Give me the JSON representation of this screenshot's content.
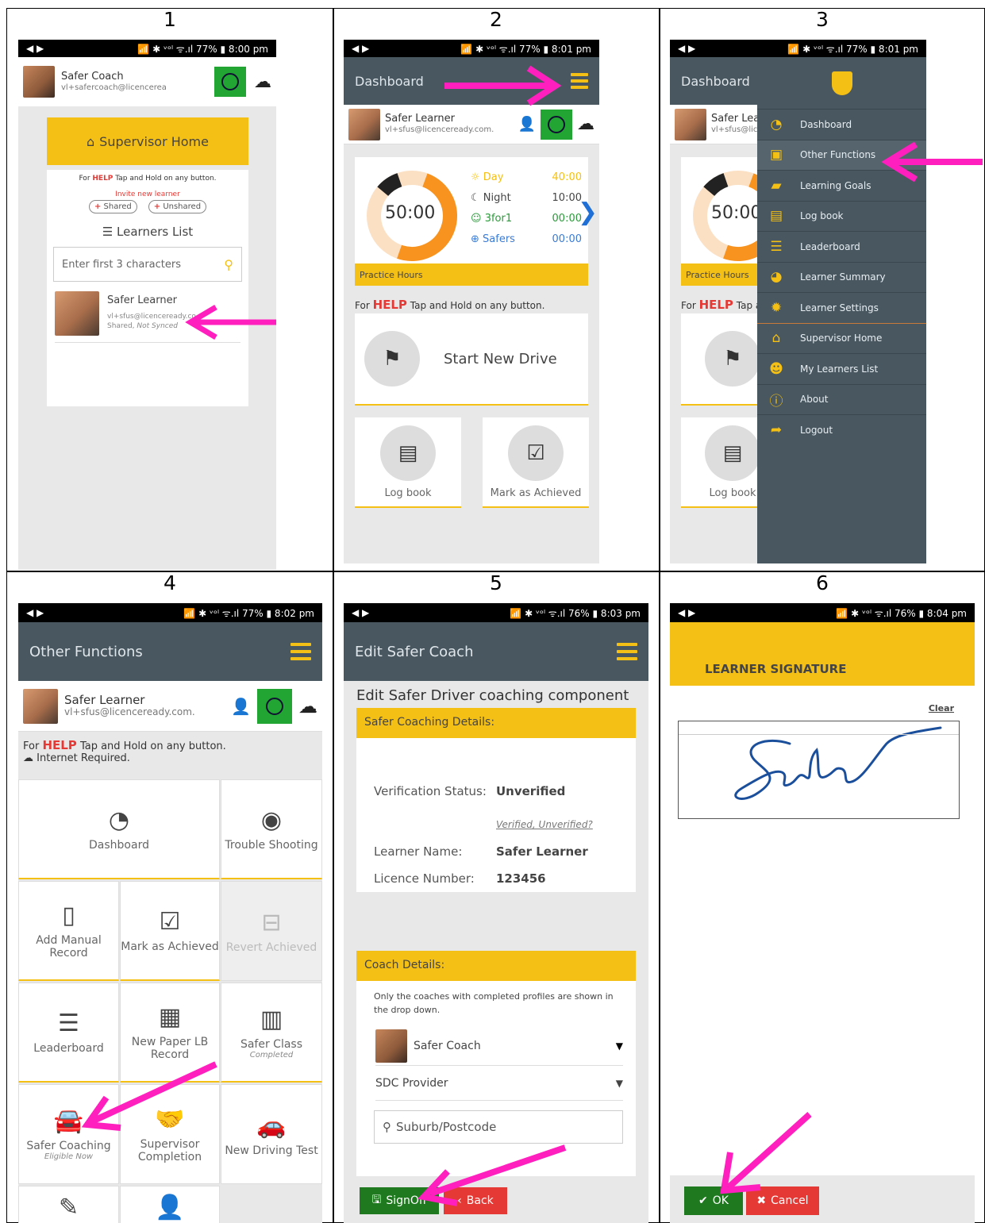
{
  "steps": [
    "1",
    "2",
    "3",
    "4",
    "5",
    "6"
  ],
  "colors": {
    "accent": "#f5c015",
    "header": "#485760",
    "green": "#22a532",
    "red": "#e53935",
    "arrow": "#ff1fbf",
    "help": "#e53935"
  },
  "status": [
    {
      "left": "◀ ▶",
      "right": "📶 ✱ ᵛᵒˡ ᯤ.ıl 77% ▮ 8:00 pm"
    },
    {
      "left": "◀ ▶",
      "right": "📶 ✱ ᵛᵒˡ ᯤ.ıl 77% ▮ 8:01 pm"
    },
    {
      "left": "◀ ▶",
      "right": "📶 ✱ ᵛᵒˡ ᯤ.ıl 77% ▮ 8:01 pm"
    },
    {
      "left": "◀ ▶",
      "right": "📶 ✱ ᵛᵒˡ ᯤ.ıl 77% ▮ 8:02 pm"
    },
    {
      "left": "◀ ▶",
      "right": "📶 ✱ ᵛᵒˡ ᯤ.ıl 76% ▮ 8:03 pm"
    },
    {
      "left": "◀ ▶",
      "right": "📶 ✱ ᵛᵒˡ ᯤ.ıl 76% ▮ 8:04 pm"
    }
  ],
  "coach": {
    "name": "Safer Coach",
    "email": "vl+safercoach@licencerea"
  },
  "learner": {
    "name": "Safer Learner",
    "email": "vl+sfus@licenceready.com."
  },
  "p1": {
    "supervisor_home": "Supervisor Home",
    "help_pre": "For ",
    "help": "HELP",
    "help_post": " Tap and Hold on any button.",
    "invite": "Invite new learner",
    "shared": "Shared",
    "unshared": "Unshared",
    "learners_list": "Learners List",
    "search_placeholder": "Enter first 3 characters",
    "row": {
      "name": "Safer Learner",
      "email": "vl+sfus@licenceready.co",
      "status": "Shared, ",
      "status_em": "Not Synced"
    }
  },
  "p2": {
    "title": "Dashboard",
    "total": "50:00",
    "hours": [
      {
        "label": "Day",
        "value": "40:00",
        "icon": "☼"
      },
      {
        "label": "Night",
        "value": "10:00",
        "icon": "☾"
      },
      {
        "label": "3for1",
        "value": "00:00",
        "icon": "☺"
      },
      {
        "label": "Safers",
        "value": "00:00",
        "icon": "⊕"
      }
    ],
    "practice": "Practice Hours",
    "help_pre": "For ",
    "help": "HELP",
    "help_post": " Tap and Hold on any button.",
    "start": "Start New Drive",
    "logbook": "Log book",
    "mark": "Mark as Achieved"
  },
  "p3": {
    "title": "Dashboard",
    "learner_short": "Safer Lear",
    "email_short": "vl+sfus@lice",
    "total": "50:00",
    "practice": "Practice Hours",
    "help_pre": "For ",
    "help": "HELP",
    "help_post": " Tap a",
    "logbook": "Log book",
    "menu": [
      "Dashboard",
      "Other Functions",
      "Learning Goals",
      "Log book",
      "Leaderboard",
      "Learner Summary",
      "Learner Settings",
      "Supervisor Home",
      "My Learners List",
      "About",
      "Logout"
    ]
  },
  "p4": {
    "title": "Other Functions",
    "help_pre": "For ",
    "help": "HELP",
    "help_post": " Tap and Hold on any button.",
    "internet": "Internet Required.",
    "tiles": {
      "dashboard": "Dashboard",
      "trouble": "Trouble Shooting",
      "manual": "Add Manual Record",
      "mark": "Mark as Achieved",
      "revert": "Revert Achieved",
      "leader": "Leaderboard",
      "paper": "New Paper LB Record",
      "class": "Safer Class",
      "class_sub": "Completed",
      "coaching": "Safer Coaching",
      "coaching_sub": "Eligible Now",
      "supervisor": "Supervisor Completion",
      "test": "New Driving Test"
    }
  },
  "p5": {
    "title": "Edit Safer Coach",
    "heading": "Edit Safer Driver coaching component",
    "details": "Safer Coaching Details:",
    "ver_label": "Verification Status:",
    "ver_value": "Unverified",
    "ver_link": "Verified, Unverified?",
    "ln_label": "Learner Name:",
    "ln_value": "Safer Learner",
    "lic_label": "Licence Number:",
    "lic_value": "123456",
    "coach_details": "Coach Details:",
    "coach_note": "Only the coaches with completed profiles are shown in the drop down.",
    "coach_select": "Safer Coach",
    "provider": "SDC Provider",
    "suburb_placeholder": "Suburb/Postcode",
    "signoff": "SignOff",
    "back": "Back"
  },
  "p6": {
    "title": "LEARNER SIGNATURE",
    "clear": "Clear",
    "ok": "OK",
    "cancel": "Cancel"
  }
}
